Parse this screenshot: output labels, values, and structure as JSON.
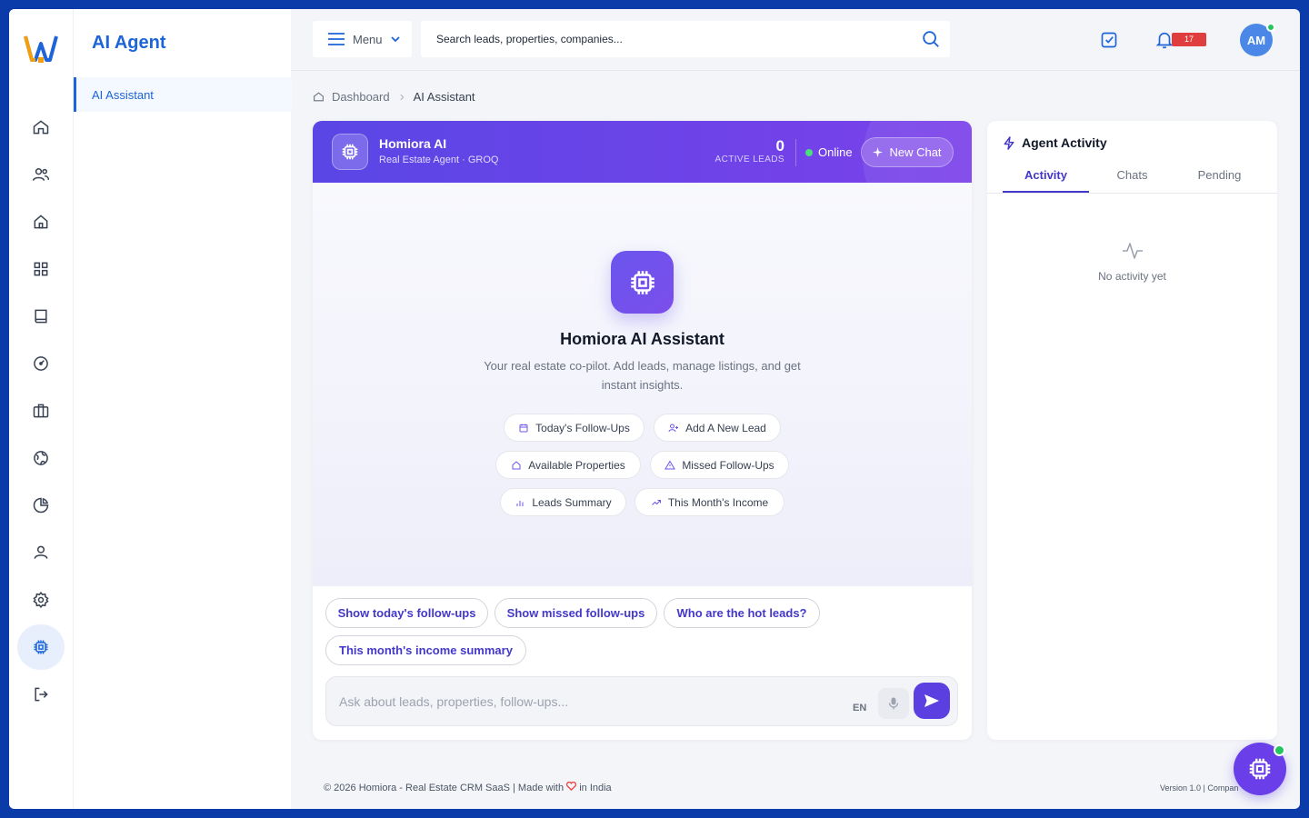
{
  "brand": {
    "primary": "#1d64d8",
    "accent": "#5b3fe0",
    "frame_bg": "#0b3ba8"
  },
  "sidebar": {
    "title": "AI Agent",
    "active_item": "AI Assistant",
    "rail_icons": [
      "home-icon",
      "users-icon",
      "house-icon",
      "grid-icon",
      "book-icon",
      "dashboard-icon",
      "briefcase-icon",
      "globe-icon",
      "pie-chart-icon",
      "user-icon",
      "settings-icon",
      "chip-icon",
      "logout-icon"
    ]
  },
  "topbar": {
    "menu_label": "Menu",
    "search_placeholder": "Search leads, properties, companies...",
    "notification_count": "17",
    "avatar_initials": "AM"
  },
  "breadcrumb": {
    "home": "Dashboard",
    "current": "AI Assistant"
  },
  "chat": {
    "bot_name": "Homiora AI",
    "bot_role": "Real Estate Agent",
    "bot_engine": "GROQ",
    "active_leads_count": "0",
    "active_leads_label": "ACTIVE LEADS",
    "status": "Online",
    "new_chat_label": "New Chat",
    "hero_title": "Homiora AI Assistant",
    "hero_desc": "Your real estate co-pilot. Add leads, manage listings, and get instant insights.",
    "chips": [
      {
        "label": "Today's Follow-Ups",
        "icon": "calendar-icon"
      },
      {
        "label": "Add A New Lead",
        "icon": "user-plus-icon"
      },
      {
        "label": "Available Properties",
        "icon": "house-icon"
      },
      {
        "label": "Missed Follow-Ups",
        "icon": "warning-icon"
      },
      {
        "label": "Leads Summary",
        "icon": "bar-chart-icon"
      },
      {
        "label": "This Month's Income",
        "icon": "trend-up-icon"
      }
    ],
    "suggestions": [
      "Show today's follow-ups",
      "Show missed follow-ups",
      "Who are the hot leads?",
      "This month's income summary"
    ],
    "input_placeholder": "Ask about leads, properties, follow-ups...",
    "lang": "EN"
  },
  "activity": {
    "title": "Agent Activity",
    "tabs": [
      "Activity",
      "Chats",
      "Pending"
    ],
    "active_tab": "Activity",
    "empty_text": "No activity yet"
  },
  "footer": {
    "left_before_heart": "© 2026 Homiora - Real Estate CRM SaaS | Made with",
    "left_after_heart": "in India",
    "right": "Version 1.0 | Compan"
  }
}
